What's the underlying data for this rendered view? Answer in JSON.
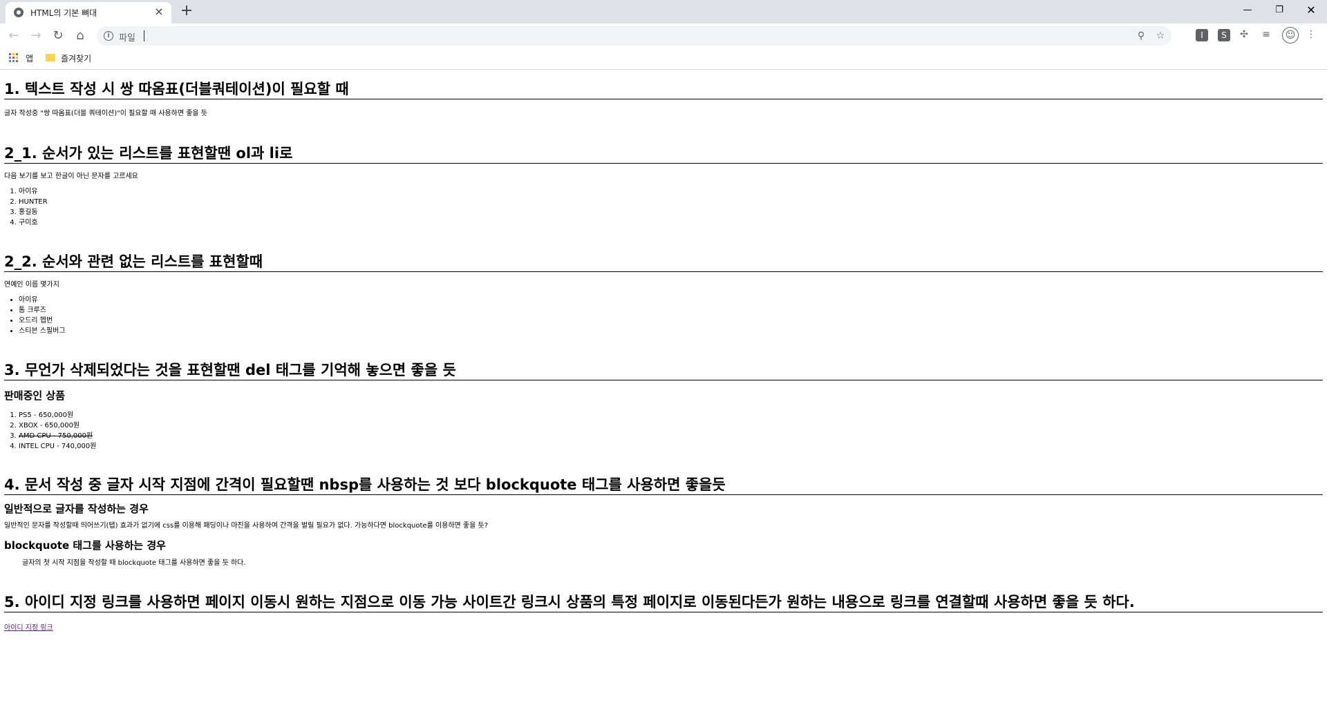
{
  "browser": {
    "tab_title": "HTML의 기본 뼈대",
    "tab_close": "×",
    "new_tab": "+",
    "omnibox_label": "파일",
    "bookmarks": {
      "apps": "앱",
      "favorites": "즐겨찾기"
    },
    "window": {
      "minimize": "—",
      "maximize": "❐",
      "close": "✕"
    }
  },
  "content": {
    "s1": {
      "heading": "1. 텍스트 작성 시 쌍 따옴표(더블쿼테이션)이 필요할 때",
      "text": "글자 작성중 \"쌍 따옴표(더블 쿼테이션)\"이 필요할 때 사용하면 좋을 듯"
    },
    "s2_1": {
      "heading": "2_1. 순서가 있는 리스트를 표현할땐 ol과 li로",
      "text": "다음 보기를 보고 한글이 아닌 문자를 고르세요",
      "items": [
        "아이유",
        "HUNTER",
        "홍길동",
        "구미호"
      ]
    },
    "s2_2": {
      "heading": "2_2. 순서와 관련 없는 리스트를 표현할때",
      "text": "연예인 이름 몇가지",
      "items": [
        "아이유",
        "톰 크루즈",
        "오드리 헵번",
        "스티븐 스필버그"
      ]
    },
    "s3": {
      "heading": "3. 무언가 삭제되었다는 것을 표현할땐 del 태그를 기억해 놓으면 좋을 듯",
      "subheading": "판매중인 상품",
      "items": [
        "PS5 - 650,000원",
        "XBOX - 650,000원",
        "AMD CPU - 750,000원",
        "INTEL CPU - 740,000원"
      ]
    },
    "s4": {
      "heading": "4. 문서 작성 중 글자 시작 지점에 간격이 필요할땐 nbsp를 사용하는 것 보다 blockquote 태그를 사용하면 좋을듯",
      "sub1": "일반적으로 글자를 작성하는 경우",
      "text1": "일반적인 문자를 작성할때 띄어쓰기(탭) 효과가 없기에 css를 이용해 패딩이나 마진을 사용하여 간격을 벌릴 필요가 없다. 가능하다면 blockquote를 이용하면 좋을 듯?",
      "sub2": "blockquote 태그를 사용하는 경우",
      "quote": "글자의 첫 시작 지점을 작성할 때 blockquote 태그를 사용하면 좋을 듯 하다."
    },
    "s5": {
      "heading": "5. 아이디 지정 링크를 사용하면 페이지 이동시 원하는 지점으로 이동 가능 사이트간 링크시 상품의 특정 페이지로 이동된다든가 원하는 내용으로 링크를 연결할때 사용하면 좋을 듯 하다.",
      "link": "아이디 지정 링크"
    }
  }
}
